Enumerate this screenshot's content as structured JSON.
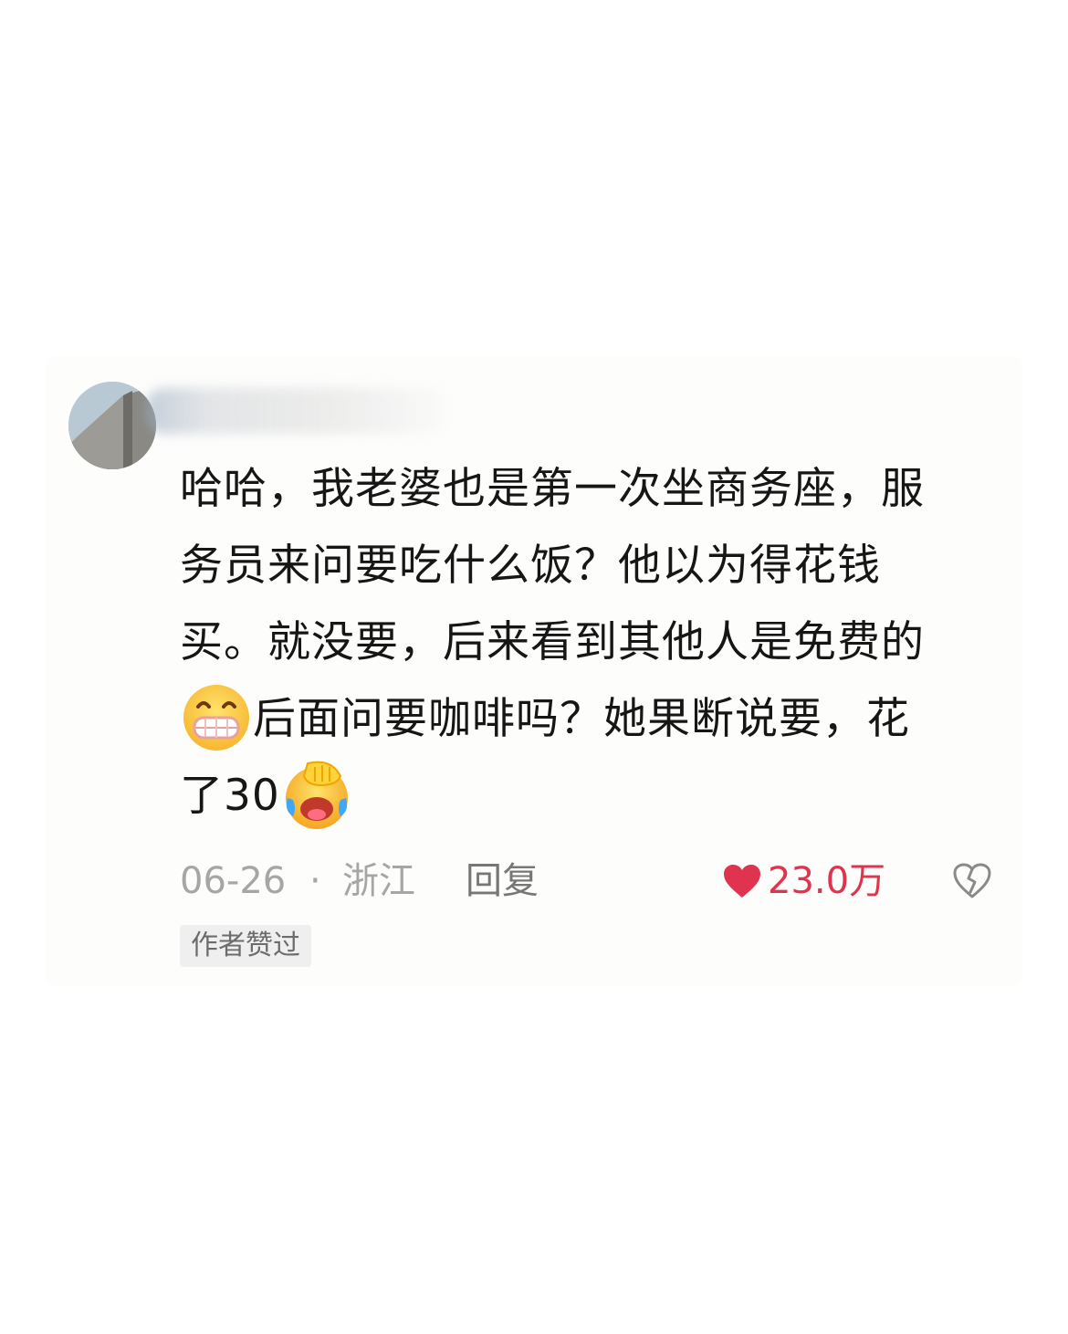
{
  "comment": {
    "avatar_icon": "avatar-icon",
    "lines": [
      "哈哈，我老婆也是第一次坐商务座，服",
      "务员来问要吃什么饭？他以为得花钱",
      "买。就没要，后来看到其他人是免费的",
      "后面问要咖啡吗？她果断说要，花",
      "了30"
    ],
    "emoji_grin": "grinning-face-icon",
    "emoji_facepalm": "facepalm-laughing-icon"
  },
  "meta": {
    "date": "06-26",
    "separator": "·",
    "location": "浙江",
    "reply_label": "回复",
    "like_count": "23.0万",
    "like_color": "#e0334f",
    "like_icon": "heart-icon",
    "dislike_icon": "broken-heart-icon"
  },
  "badge": {
    "label": "作者赞过"
  }
}
